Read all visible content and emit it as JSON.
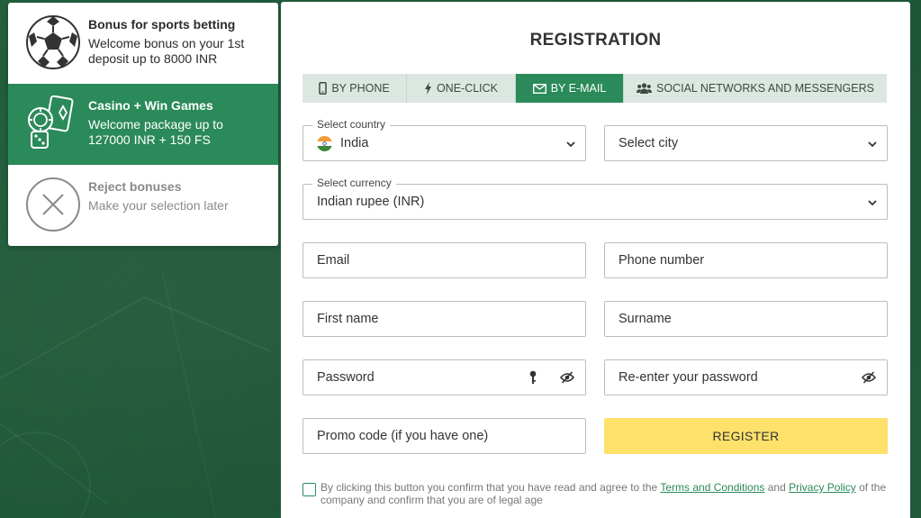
{
  "bonuses": [
    {
      "title": "Bonus for sports betting",
      "desc": "Welcome bonus on your 1st deposit up to 8000 INR",
      "icon": "soccer-ball-icon",
      "active": false
    },
    {
      "title": "Casino + Win Games",
      "desc": "Welcome package up to 127000 INR + 150 FS",
      "icon": "casino-chips-icon",
      "active": true
    },
    {
      "title": "Reject bonuses",
      "desc": "Make your selection later",
      "icon": "close-circle-icon",
      "active": false
    }
  ],
  "registration": {
    "title": "REGISTRATION",
    "tabs": [
      {
        "label": "BY PHONE",
        "icon": "phone-icon"
      },
      {
        "label": "ONE-CLICK",
        "icon": "lightning-icon"
      },
      {
        "label": "BY E-MAIL",
        "icon": "envelope-icon"
      },
      {
        "label": "SOCIAL NETWORKS AND MESSENGERS",
        "icon": "users-icon"
      }
    ],
    "active_tab": "BY E-MAIL",
    "country_label": "Select country",
    "country_value": "India",
    "city_placeholder": "Select city",
    "currency_label": "Select currency",
    "currency_value": "Indian rupee (INR)",
    "email_placeholder": "Email",
    "phone_placeholder": "Phone number",
    "firstname_placeholder": "First name",
    "surname_placeholder": "Surname",
    "password_placeholder": "Password",
    "repassword_placeholder": "Re-enter your password",
    "promo_placeholder": "Promo code (if you have one)",
    "register_label": "REGISTER",
    "agree_text_1": "By clicking this button you confirm that you have read and agree to the ",
    "terms_link": "Terms and Conditions",
    "agree_text_2": " and ",
    "privacy_link": "Privacy Policy",
    "agree_text_3": " of the company and confirm that you are of legal age"
  },
  "colors": {
    "background": "#1f5f3c",
    "accent": "#2b8a5a",
    "register": "#fde16b",
    "tab_bg": "#dde7e2"
  }
}
